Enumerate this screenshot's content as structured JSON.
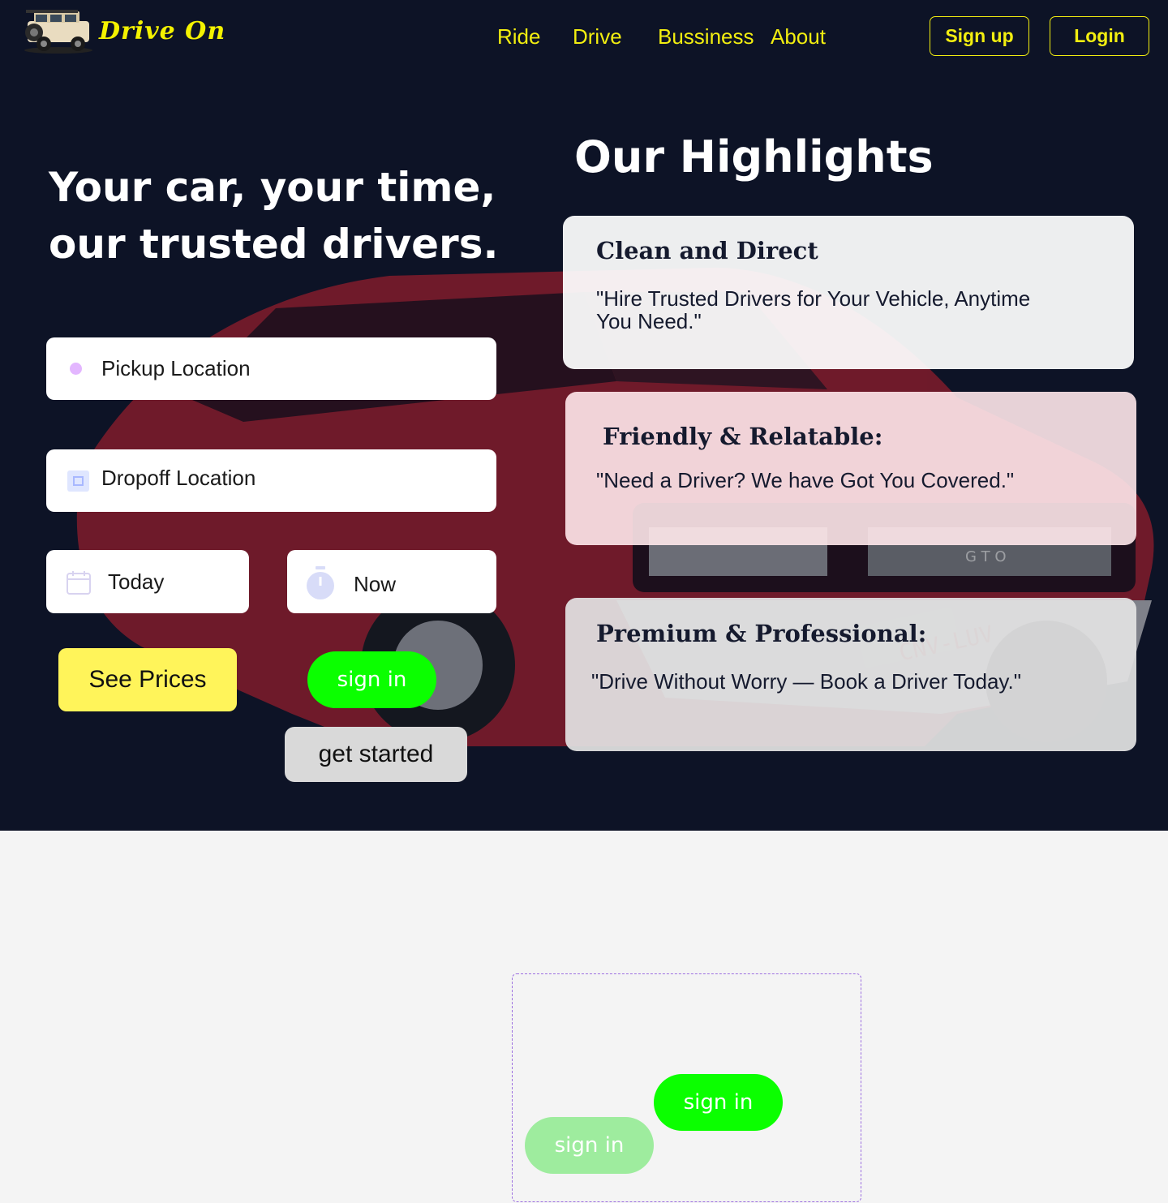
{
  "nav": {
    "brand": "Drive On",
    "links": [
      "Ride",
      "Drive",
      "Bussiness",
      "About"
    ],
    "signup_label": "Sign up",
    "login_label": "Login"
  },
  "hero": {
    "headline": "Your car, your time, our trusted drivers."
  },
  "booking": {
    "pickup_label": "Pickup Location",
    "dropoff_label": "Dropoff Location",
    "date_label": "Today",
    "time_label": "Now",
    "see_prices_label": "See Prices",
    "sign_in_label": "sign in",
    "get_started_label": "get started"
  },
  "highlights": {
    "title": "Our Highlights",
    "cards": [
      {
        "title": "Clean and Direct",
        "quote": "\"Hire Trusted Drivers for Your Vehicle, Anytime You Need.\""
      },
      {
        "title": "Friendly & Relatable:",
        "quote": "\"Need a Driver? We have Got You Covered.\""
      },
      {
        "title": "Premium & Professional:",
        "quote": "\"Drive Without Worry — Book a Driver Today.\""
      }
    ]
  },
  "car_bg": {
    "plate": "CNV-LUV",
    "badge": "G T O"
  },
  "preview": {
    "sign_in_label": "sign in",
    "sign_in_faded_label": "sign in"
  },
  "colors": {
    "hero_bg": "#0d1326",
    "brand_yellow": "#f2ee10",
    "green": "#0bff00",
    "prices_yellow": "#fff45a"
  }
}
